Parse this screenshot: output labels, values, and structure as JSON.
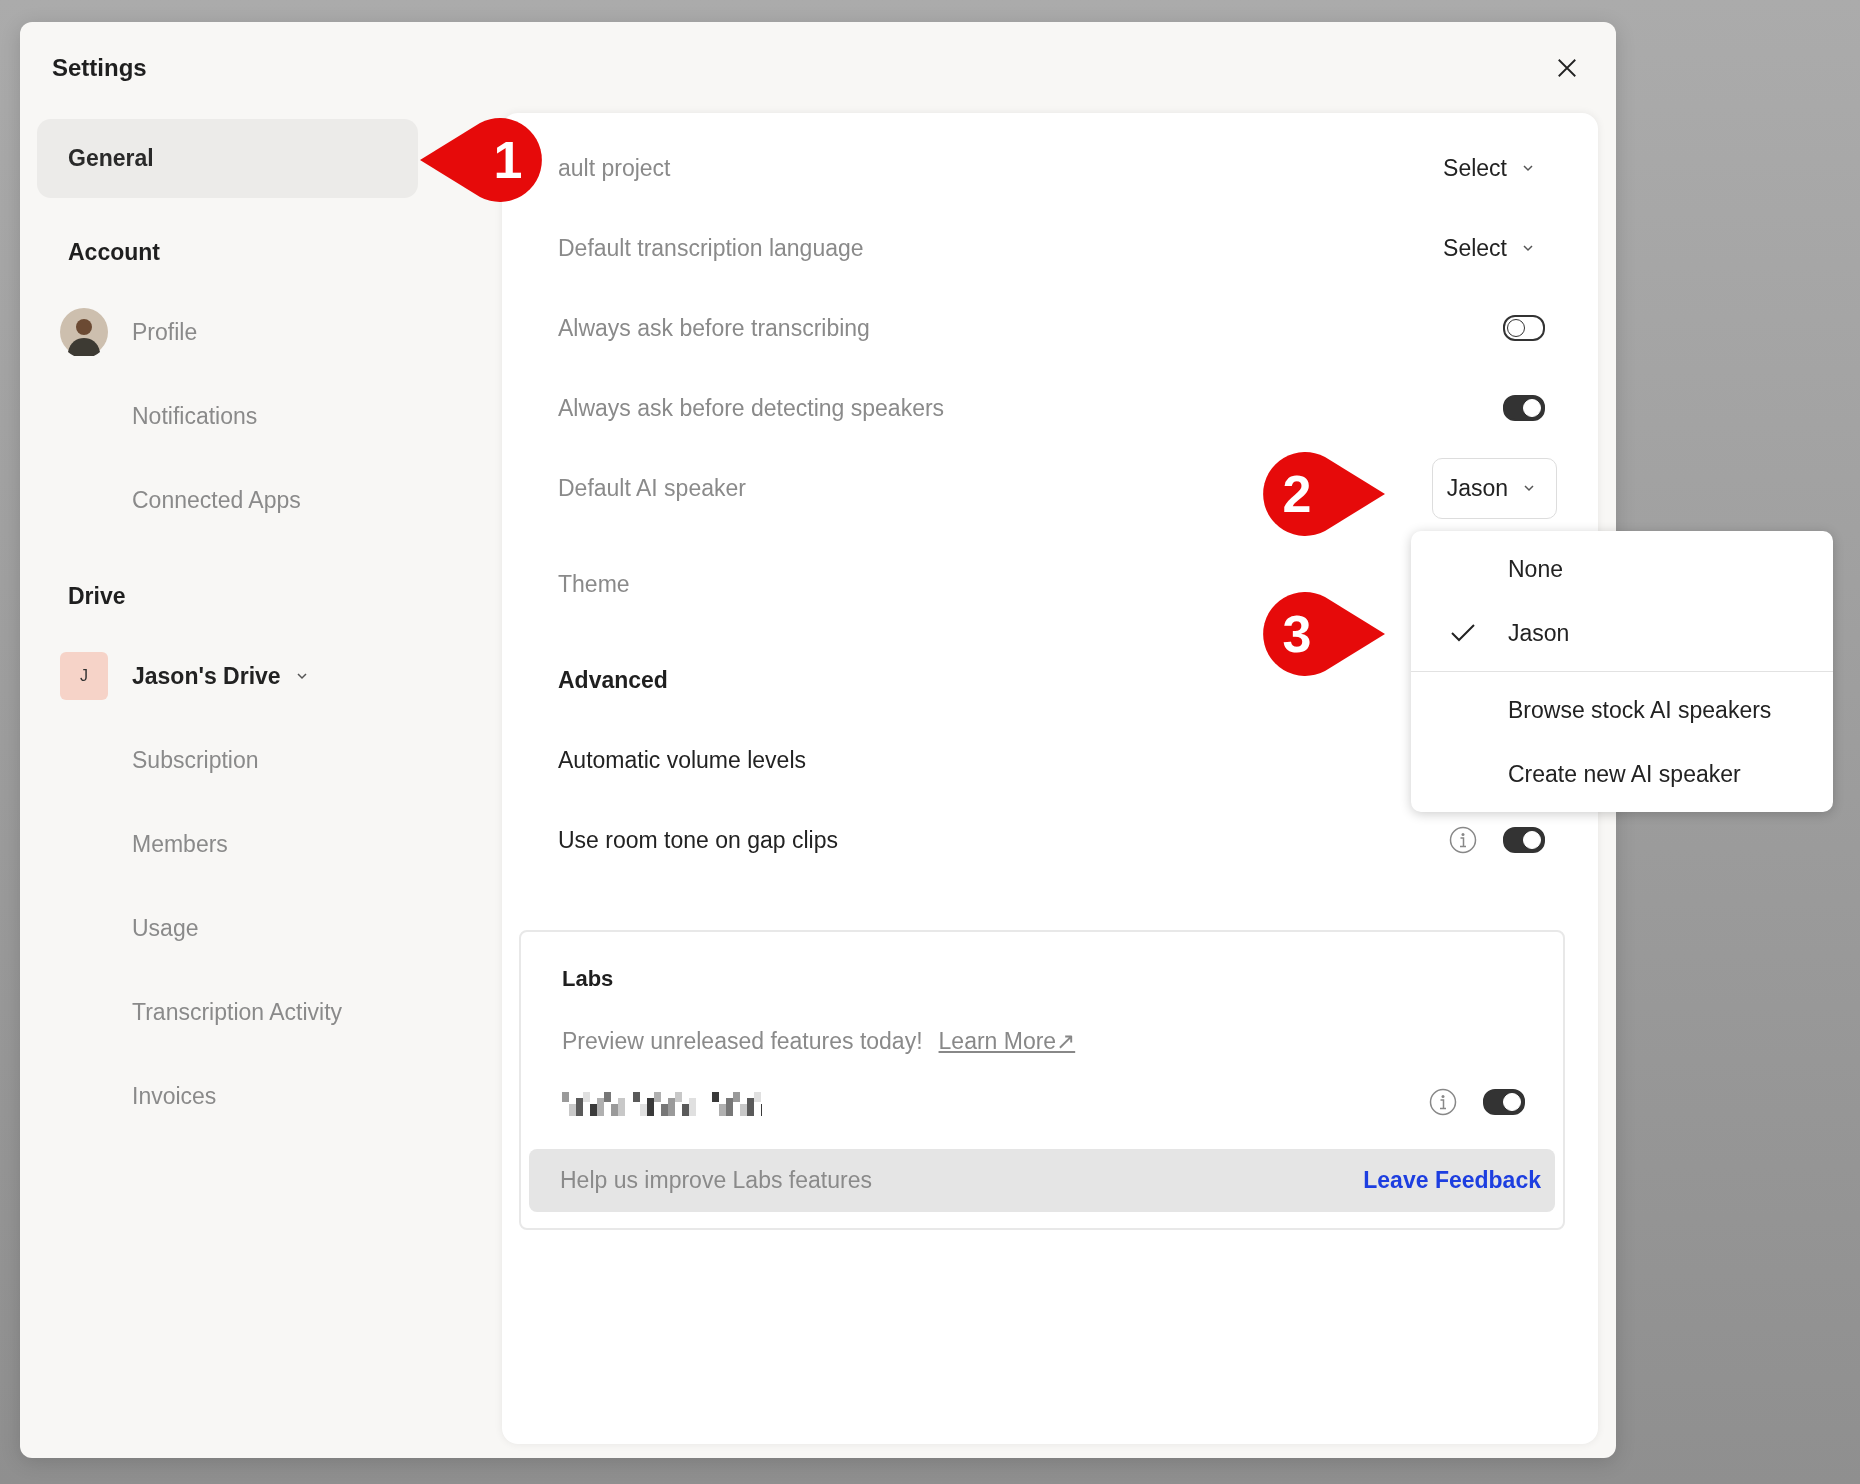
{
  "window": {
    "title": "Settings"
  },
  "sidebar": {
    "items": [
      {
        "kind": "nav",
        "label": "General",
        "selected": true
      },
      {
        "kind": "heading",
        "label": "Account"
      },
      {
        "kind": "profile",
        "label": "Profile",
        "selected": false
      },
      {
        "kind": "sub",
        "label": "Notifications",
        "selected": false
      },
      {
        "kind": "sub",
        "label": "Connected Apps",
        "selected": false
      },
      {
        "kind": "heading",
        "label": "Drive"
      },
      {
        "kind": "drive",
        "label": "Jason's Drive",
        "badge": "J",
        "selected": false
      },
      {
        "kind": "sub",
        "label": "Subscription",
        "selected": false
      },
      {
        "kind": "sub",
        "label": "Members",
        "selected": false
      },
      {
        "kind": "sub",
        "label": "Usage",
        "selected": false
      },
      {
        "kind": "sub",
        "label": "Transcription Activity",
        "selected": false
      },
      {
        "kind": "sub",
        "label": "Invoices",
        "selected": false
      }
    ]
  },
  "settings": [
    {
      "kind": "select",
      "label": "ault project",
      "value": "Select"
    },
    {
      "kind": "select",
      "label": "Default transcription language",
      "value": "Select"
    },
    {
      "kind": "toggle",
      "label": "Always ask before transcribing",
      "on": false
    },
    {
      "kind": "toggle",
      "label": "Always ask before detecting speakers",
      "on": true
    },
    {
      "kind": "boxed_select",
      "label": "Default AI speaker",
      "value": "Jason"
    },
    {
      "kind": "plain",
      "label": "Theme"
    }
  ],
  "advanced": {
    "title": "Advanced",
    "rows": [
      {
        "kind": "plain",
        "label": "Automatic volume levels"
      },
      {
        "kind": "toggle",
        "label": "Use room tone on gap clips",
        "on": true,
        "info": true
      }
    ]
  },
  "labs": {
    "title": "Labs",
    "description": "Preview unreleased features today!",
    "link": "Learn More↗",
    "feature": {
      "on": true,
      "info": true
    },
    "feedback": {
      "text": "Help us improve Labs features",
      "link": "Leave Feedback"
    }
  },
  "speaker_menu": {
    "groups": [
      [
        {
          "label": "None",
          "selected": false
        },
        {
          "label": "Jason",
          "selected": true
        }
      ],
      [
        {
          "label": "Browse stock AI speakers",
          "selected": false
        },
        {
          "label": "Create new AI speaker",
          "selected": false
        }
      ]
    ]
  },
  "callouts": [
    {
      "label": "1"
    },
    {
      "label": "2"
    },
    {
      "label": "3"
    }
  ]
}
